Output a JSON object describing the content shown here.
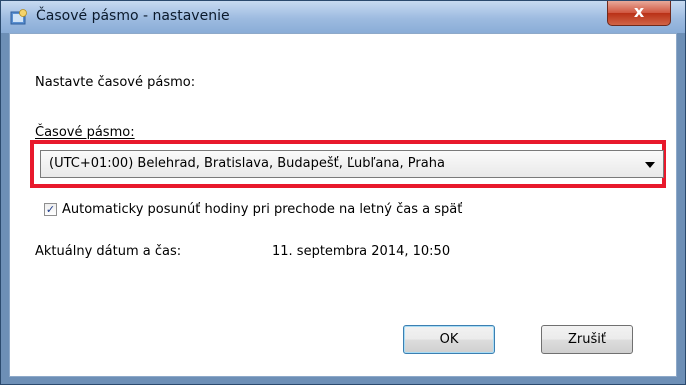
{
  "window": {
    "title": "Časové pásmo - nastavenie",
    "close_glyph": "x"
  },
  "dialog": {
    "intro": "Nastavte časové pásmo:",
    "timezone_label": "Časové pásmo:",
    "timezone_value": "(UTC+01:00) Belehrad, Bratislava, Budapešť, Ľubľana, Praha",
    "auto_dst": {
      "checked": true,
      "label": "Automaticky posunúť hodiny pri prechode na letný čas a späť"
    },
    "datetime_label": "Aktuálny dátum a čas:",
    "datetime_value": "11. septembra 2014, 10:50"
  },
  "buttons": {
    "ok": "OK",
    "cancel": "Zrušiť"
  },
  "colors": {
    "highlight": "#e8192c",
    "titlebar": "#9dbbe0",
    "close_button": "#c8452f"
  }
}
